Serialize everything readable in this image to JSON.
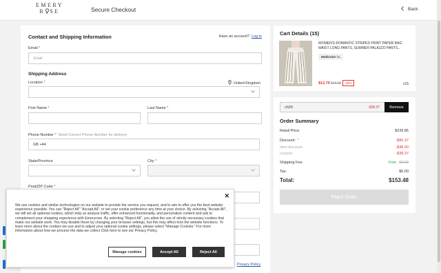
{
  "header": {
    "logo_top": "EMERY",
    "logo_bottom_left": "R",
    "logo_bottom_right": "SE",
    "title": "Secure Checkout",
    "back_label": "Back"
  },
  "contact": {
    "title": "Contact and Shipping Information",
    "have_account": "Have an account?",
    "login": "Log in",
    "email_label": "Email",
    "email_placeholder": "Email",
    "shipping_title": "Shipping Address",
    "location_label": "Location",
    "location_country": "United Kingdom",
    "first_name_label": "First Name",
    "last_name_label": "Last Name",
    "phone_label": "Phone Number",
    "phone_hint": "Need Correct Phone Number for delivery",
    "phone_prefix": "GB +44",
    "state_label": "State/Province",
    "city_label": "City",
    "postcode_label": "Post/ZIP Code",
    "privacy": "Privacy Policy",
    "required_mark": "*"
  },
  "cart": {
    "title": "Cart Details (15)",
    "product_name": "WOMEN'S ROMANTIC STRIPED PRINT PAPER BAG WAIST LONG PANTS, SUMMER PALAZZO PANTS...",
    "variant": "Multicolor / L",
    "price": "$12.79",
    "original_price": "$15.99",
    "discount": "-20%",
    "quantity": "x15"
  },
  "summary": {
    "coupon_code": "ch20",
    "coupon_amount": "-$38.37",
    "remove_label": "Remove",
    "title": "Order Summary",
    "retail_label": "Retail Price:",
    "retail_value": "$239.85",
    "discount_label": "Discount:",
    "discount_caret": "⌃",
    "discount_value": "-$86.37",
    "item_discount_label": "Item discount:",
    "item_discount_value": "-$48.00",
    "coupon_label": "coupon:",
    "coupon_value": "-$38.37",
    "shipping_label": "Shipping Fee:",
    "shipping_free": "Free",
    "shipping_orig": "$3.99",
    "tax_label": "Tax:",
    "tax_value": "$0.00",
    "total_label": "Total:",
    "total_value": "$153.48",
    "place_order": "Place Order"
  },
  "cookie": {
    "close_glyph": "✕",
    "text": "We use cookies and similar technologies on our website to provide the service you request, and to aim to offer you the best website experience possible. You can \"Reject All\" \"Accept All\", or set your cookie preference any time at your choice. By selecting \"Accept All\", we will set all optional cookies, which help us analyse traffic, offer enhanced functionality, and personalize content and ads to complement your shopping experience with Emeryrose. By selecting \"Reject All\", you allow the use of strictly necessary cookies that make our website work. You may disable these by changing your browser settings, but this may affect how the website functions. To learn more about the cookies we use and to adjust your optional cookie settings, please select \"Manage Cookies.\" For more information about how we process the data we collect Click here to see our Privacy Policy.",
    "manage": "Manage cookies",
    "accept": "Accept All",
    "reject": "Reject All"
  },
  "colors": {
    "accent_red": "#dd3333",
    "free_green": "#2a9d4a",
    "link_blue": "#2255aa",
    "side_tabs": [
      "#1f6fd1",
      "#2e9e46",
      "#1f6fd1"
    ]
  }
}
